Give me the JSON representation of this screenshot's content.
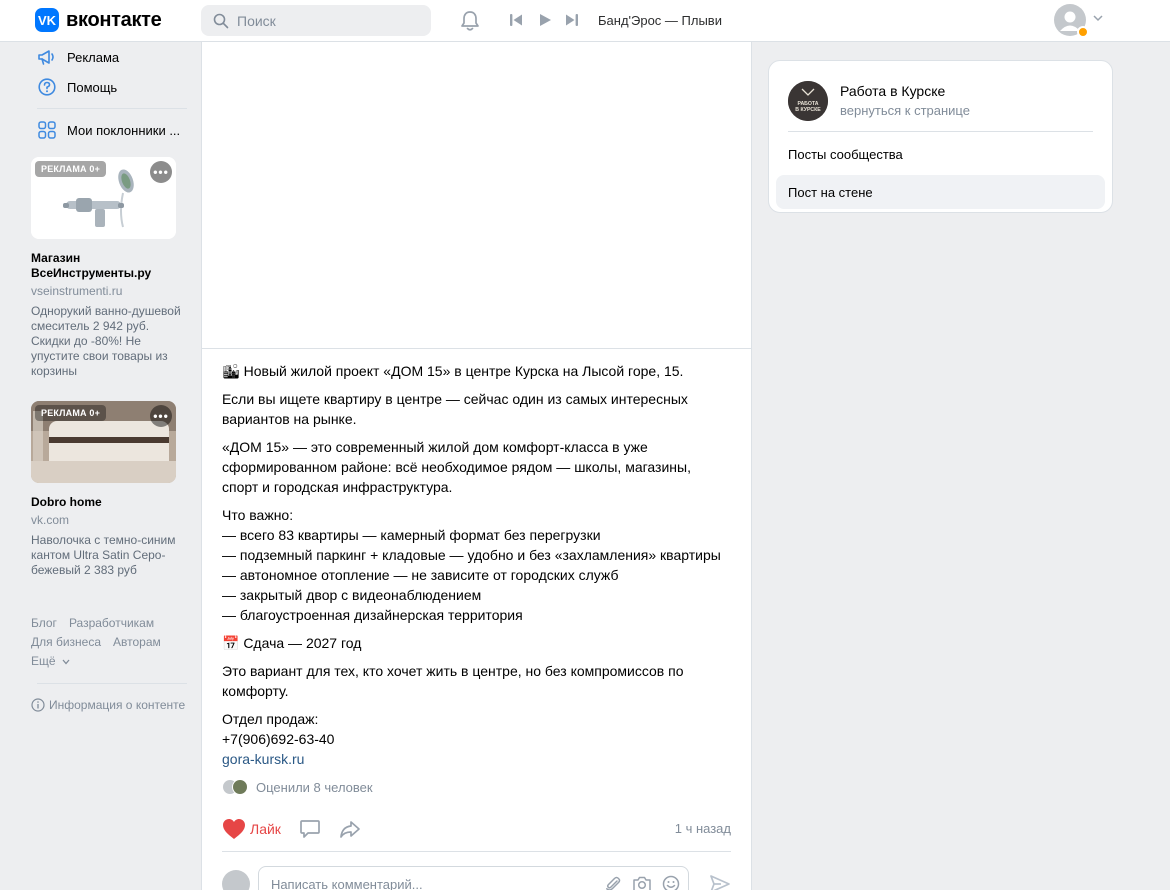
{
  "header": {
    "logo_mark": "VK",
    "logo_text": "вконтакте",
    "search_placeholder": "Поиск",
    "player_title": "Банд'Эрос — Плыви"
  },
  "sidebar": {
    "items": [
      {
        "label": "Реклама",
        "icon": "megaphone-icon"
      },
      {
        "label": "Помощь",
        "icon": "help-circle-icon"
      },
      {
        "label": "Мои поклонники ...",
        "icon": "apps-grid-icon"
      }
    ],
    "ads": [
      {
        "badge": "РЕКЛАМА 0+",
        "title": "Магазин ВсеИнструменты.ру",
        "domain": "vseinstrumenti.ru",
        "text": "Однорукий ванно-душевой смеситель 2 942 руб. Скидки до -80%! Не упустите свои товары из корзины"
      },
      {
        "badge": "РЕКЛАМА 0+",
        "title": "Dobro home",
        "domain": "vk.com",
        "text": "Наволочка с темно-синим кантом Ultra Satin Серо-бежевый 2 383 руб"
      }
    ],
    "footer": {
      "blog": "Блог",
      "developers": "Разработчикам",
      "business": "Для бизнеса",
      "authors": "Авторам",
      "more": "Ещё"
    },
    "info_content": "Информация о контенте"
  },
  "post": {
    "paragraphs": [
      "🏙 Новый жилой проект «ДОМ 15» в центре Курска на Лысой горе, 15.",
      "Если вы ищете квартиру в центре — сейчас один из самых интересных вариантов на рынке.",
      "«ДОМ 15» — это современный жилой дом комфорт-класса в уже сформированном районе: всё необходимое рядом — школы, магазины, спорт и городская инфраструктура."
    ],
    "important_title": "Что важно:",
    "important_list": [
      "— всего 83 квартиры — камерный формат без перегрузки",
      "— подземный паркинг + кладовые — удобно и без «захламления» квартиры",
      "— автономное отопление — не зависите от городских служб",
      "— закрытый двор с видеонаблюдением",
      "— благоустроенная дизайнерская территория"
    ],
    "deadline": "📅 Сдача — 2027 год",
    "closing": "Это вариант для тех, кто хочет жить в центре, но без компромиссов по комфорту.",
    "sales_title": "Отдел продаж:",
    "phone": "+7(906)692-63-40",
    "link": "gora-kursk.ru",
    "rated": "Оценили 8 человек",
    "like_label": "Лайк",
    "time": "1 ч назад",
    "comment_placeholder": "Написать комментарий..."
  },
  "right": {
    "group_name": "Работа в Курске",
    "group_logo_text": "РАБОТА В КУРСКЕ",
    "back_link": "вернуться к странице",
    "menu": [
      {
        "label": "Посты сообщества",
        "active": false
      },
      {
        "label": "Пост на стене",
        "active": true
      }
    ]
  },
  "colors": {
    "accent": "#0077ff",
    "like": "#e64646",
    "link": "#2a5885",
    "muted": "#818c99",
    "page_bg": "#edeef0"
  }
}
